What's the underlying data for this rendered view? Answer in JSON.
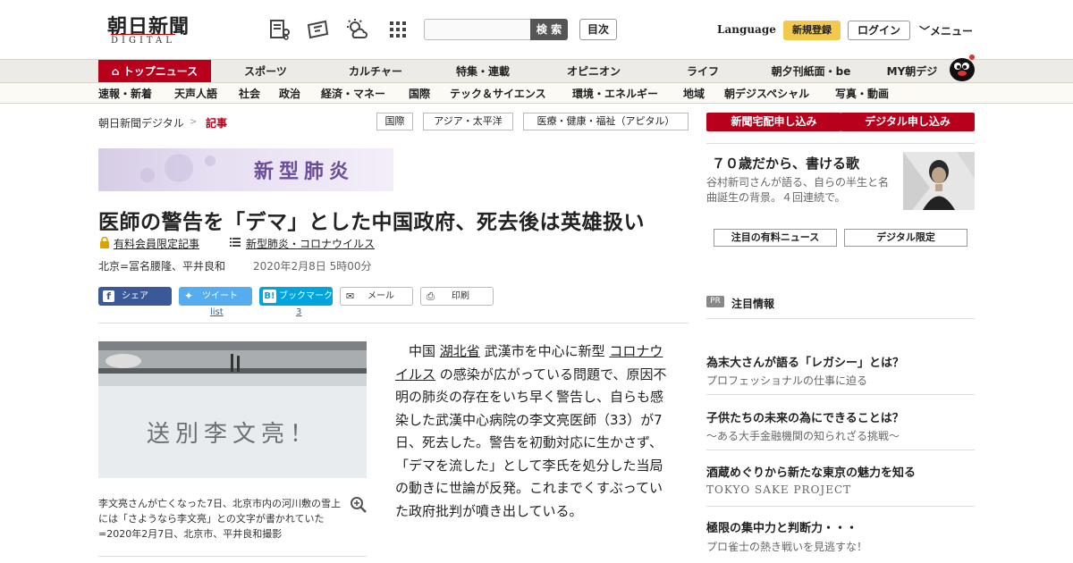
{
  "header": {
    "logo_main": "朝日新聞",
    "logo_sub": "DIGITAL",
    "icons": [
      "newspaper-scrapbook-icon",
      "ticket-icon",
      "weather-icon",
      "apps-grid-icon"
    ],
    "search_placeholder": "",
    "search_label": "検 索",
    "toc_label": "目次",
    "language_label": "Language",
    "signup_label": "新規登録",
    "login_label": "ログイン",
    "menu_label": "メニュー"
  },
  "nav_primary": [
    "トップニュース",
    "スポーツ",
    "カルチャー",
    "特集・連載",
    "オピニオン",
    "ライフ",
    "朝夕刊紙面・be",
    "MY朝デジ"
  ],
  "nav_secondary": [
    "速報・新着",
    "天声人語",
    "社会",
    "政治",
    "経済・マネー",
    "国際",
    "テック＆サイエンス",
    "環境・エネルギー",
    "地域",
    "朝デジスペシャル",
    "写真・動画"
  ],
  "breadcrumb": {
    "home": "朝日新聞デジタル",
    "sep": ">",
    "current": "記事"
  },
  "tags": [
    "国際",
    "アジア・太平洋",
    "医療・健康・福祉（アピタル）"
  ],
  "banner_label": "新型肺炎",
  "article": {
    "headline": "医師の警告を「デマ」とした中国政府、死去後は英雄扱い",
    "member_label": "有料会員限定記事",
    "topic_label": "新型肺炎・コロナウイルス",
    "byline": "北京=冨名腰隆、平井良和",
    "date": "2020年2月8日 5時00分",
    "share": {
      "facebook": "シェア",
      "twitter": "ツイート",
      "hatena": "ブックマーク",
      "mail": "メール",
      "print": "印刷",
      "twitter_count": "list",
      "hatena_count": "3"
    },
    "photo_text": "送別李文亮！",
    "caption": "李文亮さんが亡くなった7日、北京市内の河川敷の雪上には「さようなら李文亮」との文字が書かれていた=2020年2月7日、北京市、平井良和撮影",
    "body": {
      "p1": "中国",
      "l1": "湖北省",
      "p2": "武漢市を中心に新型",
      "l2": "コロナウイルス",
      "p3": "の感染が広がっている問題で、原因不明の肺炎の存在をいち早く警告し、自らも感染した武漢中心病院の李文亮医師（33）が7日、死去した。警告を初動対応に生かさず、「デマを流した」として李氏を処分した当局の動きに世論が反発。これまでくすぶっていた政府批判が噴き出している。"
    }
  },
  "sidebar": {
    "paper_btn": "新聞宅配申し込み",
    "digital_btn": "デジタル申し込み",
    "promo_title": "７０歳だから、書ける歌",
    "promo_text": "谷村新司さんが語る、自らの半生と名曲誕生の背景。４回連続で。",
    "tab_paid": "注目の有料ニュース",
    "tab_digital": "デジタル限定",
    "pr_badge": "PR",
    "pr_title": "注目情報",
    "pr_items": [
      {
        "head": "為末大さんが語る「レガシー」とは？",
        "sub": "プロフェッショナルの仕事に迫る"
      },
      {
        "head": "子供たちの未来の為にできることは？",
        "sub": "～ある大手金融機関の知られざる挑戦～"
      },
      {
        "head": "酒蔵めぐりから新たな東京の魅力を知る",
        "sub": "TOKYO SAKE PROJECT"
      },
      {
        "head": "極限の集中力と判断力・・・",
        "sub": "プロ雀士の熱き戦いを見逃すな！"
      }
    ]
  },
  "colors": {
    "brand_red": "#b8001c",
    "signup_yellow": "#f2c94c",
    "facebook": "#3b5998",
    "twitter": "#55acee",
    "hatena": "#00a4de"
  }
}
